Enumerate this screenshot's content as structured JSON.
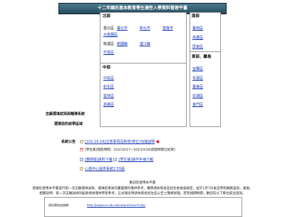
{
  "banner": {
    "title": "十二年國民基本教育學生適性入學資料管理平臺"
  },
  "north": {
    "title": "北部",
    "rows": [
      {
        "label": "基北區",
        "links": [
          "臺北市",
          "新北市",
          "基隆市"
        ]
      },
      {
        "label": "",
        "links": [
          "大桃園區"
        ]
      },
      {
        "label": "",
        "links": [
          "竹苗區"
        ]
      },
      {
        "label": "桃連區",
        "links": [
          "桃園縣",
          "連江縣"
        ]
      }
    ]
  },
  "south": {
    "title": "南部",
    "links": [
      "臺南區",
      "高雄區",
      "屏東區"
    ]
  },
  "central": {
    "title": "中部",
    "links": [
      "中投區",
      "彰化區",
      "雲林區",
      "嘉義區"
    ]
  },
  "east": {
    "title": "東部、離島",
    "links": [
      "宜蘭區",
      "花蓮區",
      "臺東區",
      "澎湖區",
      "金門區"
    ]
  },
  "side_labels": {
    "exam": "志願選填試探與輔導系統",
    "choose": "選擇您的就學區域"
  },
  "announce": {
    "label": "系統公告",
    "link": "[102.10.16]注意事項及新增(修正)功能說明"
  },
  "student": {
    "prefix": "[學生版]",
    "text": "開放時間：102/10/17~102/10/30(開放時間已結束)"
  },
  "teacher": {
    "links": [
      "[教師版]資料下載",
      "[學生版]操作手冊下載"
    ]
  },
  "manual": {
    "link": "心測中心提供系統2.55版"
  },
  "footer": {
    "line1": "歡迎您使用本平臺",
    "line2": "感謝您使用本平臺進行第一次志願選填試探，選填結束後的畫面資料僅供參考，實際請依照各區招生委員會規定，並於1月7日後自學校網路查詢，謝謝。",
    "line3": "相關說明：第一次志願試探的擬真情境僅供學習參考，正式報名時請依照各招生區公告之簡章辦理，若有相關問題，歡迎向以下單位提出諮詢。",
    "box_label": "資訊學校諮詢網：",
    "box_link": "http://pegasus.edu.tw/output/search.php"
  }
}
